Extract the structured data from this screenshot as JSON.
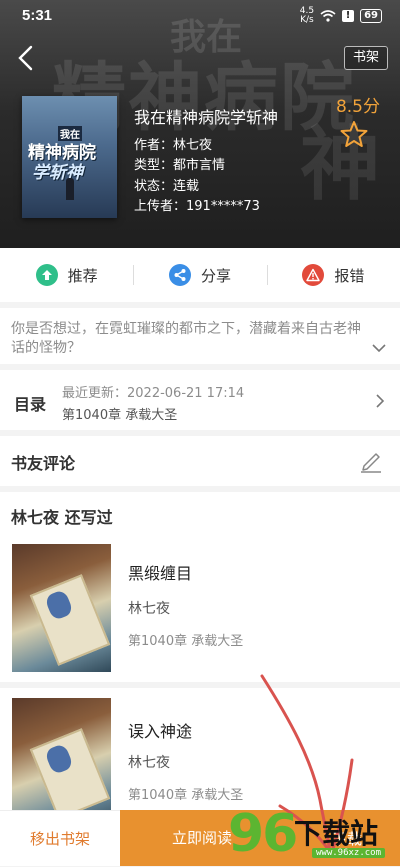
{
  "status_bar": {
    "time": "5:31",
    "net_speed_value": "4.5",
    "net_speed_unit": "K/s",
    "alert_glyph": "!",
    "battery": "69"
  },
  "header": {
    "shelf_label": "书架",
    "backdrop_title_small": "我在",
    "backdrop_title_large": "精神病院",
    "backdrop_title_extra": "神",
    "cover_line1": "我在",
    "cover_line2": "精神病院",
    "cover_line3": "学斩神",
    "book_title": "我在精神病院学斩神",
    "author": "作者：林七夜",
    "genre": "类型：都市言情",
    "status": "状态：连载",
    "uploader": "上传者：191*****73",
    "rating": "8.5分"
  },
  "actions": [
    {
      "label": "推荐",
      "icon": "upload-arrow-icon",
      "color": "#2fbf8a"
    },
    {
      "label": "分享",
      "icon": "share-icon",
      "color": "#3a8ee6"
    },
    {
      "label": "报错",
      "icon": "warning-icon",
      "color": "#e24a3b"
    }
  ],
  "intro": {
    "text": "你是否想过，在霓虹璀璨的都市之下，潜藏着来自古老神话的怪物？"
  },
  "toc": {
    "label": "目录",
    "latest_update": "最近更新：2022-06-21 17:14",
    "latest_chapter": "第1040章 承载大圣"
  },
  "comments": {
    "label": "书友评论"
  },
  "author_works": {
    "title": "林七夜  还写过",
    "items": [
      {
        "name": "黑缎缠目",
        "author": "林七夜",
        "chapter": "第1040章 承载大圣"
      },
      {
        "name": "误入神途",
        "author": "林七夜",
        "chapter": "第1040章 承载大圣"
      }
    ]
  },
  "bottom_bar": {
    "remove_label": "移出书架",
    "read_label": "立即阅读",
    "download_label": "下载"
  },
  "watermark": {
    "number": "96",
    "text": "下载站",
    "url": "www.96xz.com"
  },
  "colors": {
    "accent": "#e8912f",
    "rating": "#f2a33a",
    "watermark_green": "#5cb531",
    "scribble": "#d9534f"
  }
}
